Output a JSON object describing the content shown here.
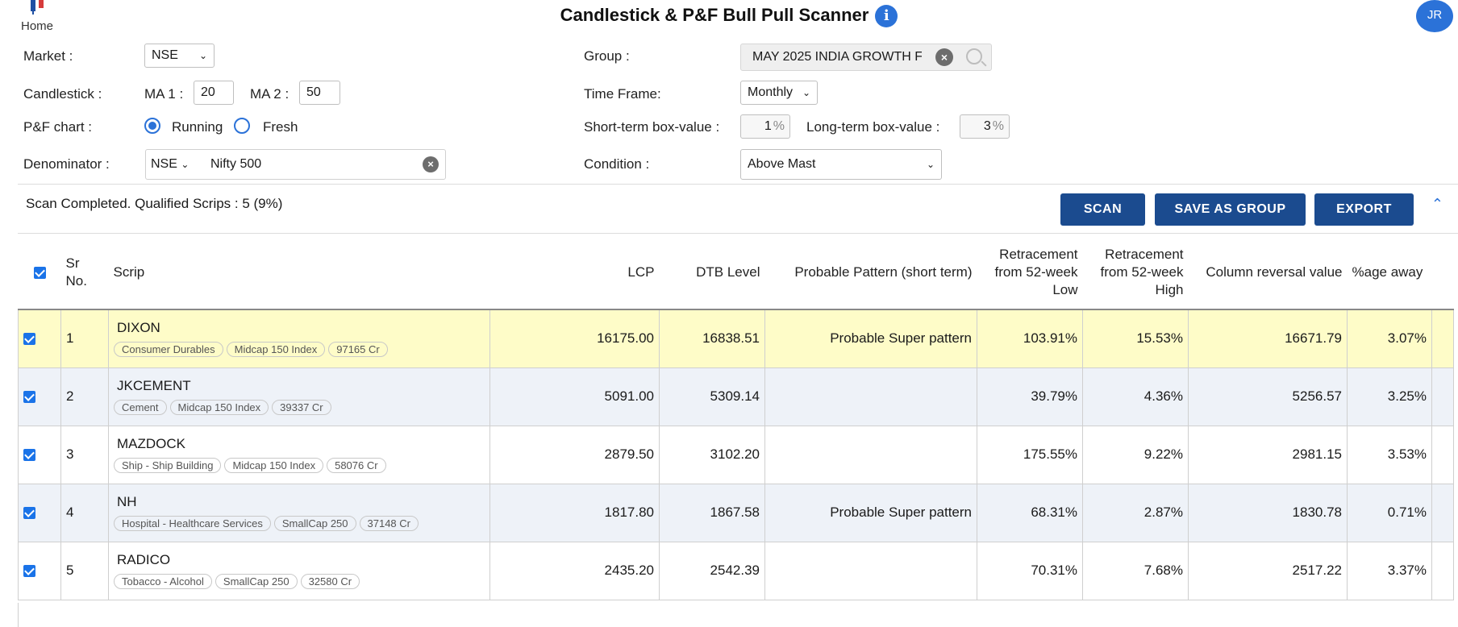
{
  "header": {
    "home_label": "Home",
    "title": "Candlestick & P&F Bull Pull Scanner",
    "info_glyph": "i",
    "avatar_initials": "JR"
  },
  "form": {
    "market_label": "Market :",
    "market_value": "NSE",
    "group_label": "Group :",
    "group_value": "MAY 2025 INDIA GROWTH F",
    "candlestick_label": "Candlestick :",
    "ma1_label": "MA 1 :",
    "ma1_value": "20",
    "ma2_label": "MA 2 :",
    "ma2_value": "50",
    "timeframe_label": "Time Frame:",
    "timeframe_value": "Monthly",
    "pnf_label": "P&F chart :",
    "running_label": "Running",
    "fresh_label": "Fresh",
    "short_box_label": "Short-term box-value :",
    "short_box_value": "1",
    "long_box_label": "Long-term box-value :",
    "long_box_value": "3",
    "percent_sign": "%",
    "denominator_label": "Denominator :",
    "denominator_market": "NSE",
    "denominator_index": "Nifty 500",
    "condition_label": "Condition :",
    "condition_value": "Above Mast"
  },
  "status": {
    "text": "Scan Completed. Qualified Scrips : 5 (9%)",
    "scan_button": "SCAN",
    "save_group_button": "SAVE AS GROUP",
    "export_button": "EXPORT"
  },
  "table": {
    "headers": {
      "sr": "Sr No.",
      "scrip": "Scrip",
      "lcp": "LCP",
      "dtb": "DTB Level",
      "pattern": "Probable Pattern (short term)",
      "ret_low": "Retracement from 52-week Low",
      "ret_high": "Retracement from 52-week High",
      "col_rev": "Column reversal value",
      "away": "%age away"
    },
    "rows": [
      {
        "sr": "1",
        "name": "DIXON",
        "sector": "Consumer Durables",
        "index": "Midcap 150 Index",
        "mcap": "97165 Cr",
        "lcp": "16175.00",
        "dtb": "16838.51",
        "pattern": "Probable Super pattern",
        "ret_low": "103.91%",
        "ret_high": "15.53%",
        "col_rev": "16671.79",
        "away": "3.07%"
      },
      {
        "sr": "2",
        "name": "JKCEMENT",
        "sector": "Cement",
        "index": "Midcap 150 Index",
        "mcap": "39337 Cr",
        "lcp": "5091.00",
        "dtb": "5309.14",
        "pattern": "",
        "ret_low": "39.79%",
        "ret_high": "4.36%",
        "col_rev": "5256.57",
        "away": "3.25%"
      },
      {
        "sr": "3",
        "name": "MAZDOCK",
        "sector": "Ship - Ship Building",
        "index": "Midcap 150 Index",
        "mcap": "58076 Cr",
        "lcp": "2879.50",
        "dtb": "3102.20",
        "pattern": "",
        "ret_low": "175.55%",
        "ret_high": "9.22%",
        "col_rev": "2981.15",
        "away": "3.53%"
      },
      {
        "sr": "4",
        "name": "NH",
        "sector": "Hospital - Healthcare Services",
        "index": "SmallCap 250",
        "mcap": "37148 Cr",
        "lcp": "1817.80",
        "dtb": "1867.58",
        "pattern": "Probable Super pattern",
        "ret_low": "68.31%",
        "ret_high": "2.87%",
        "col_rev": "1830.78",
        "away": "0.71%"
      },
      {
        "sr": "5",
        "name": "RADICO",
        "sector": "Tobacco - Alcohol",
        "index": "SmallCap 250",
        "mcap": "32580 Cr",
        "lcp": "2435.20",
        "dtb": "2542.39",
        "pattern": "",
        "ret_low": "70.31%",
        "ret_high": "7.68%",
        "col_rev": "2517.22",
        "away": "3.37%"
      }
    ]
  }
}
